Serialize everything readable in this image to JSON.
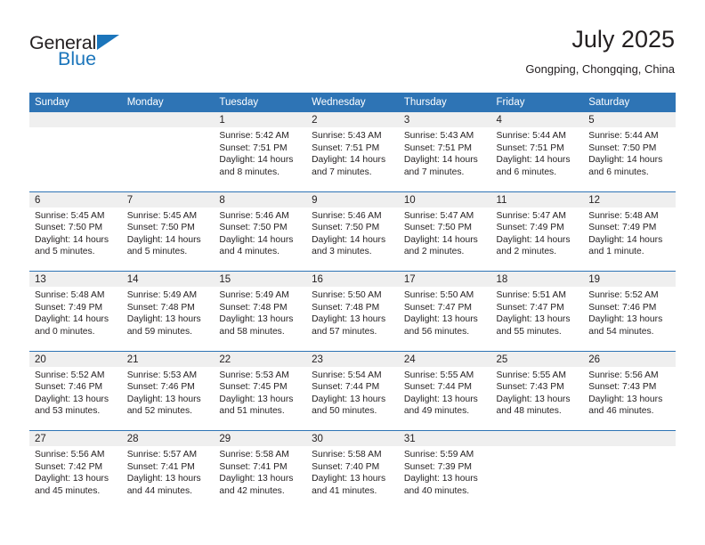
{
  "brand": {
    "name_top": "General",
    "name_bottom": "Blue",
    "accent_color": "#1b75bb"
  },
  "header": {
    "title": "July 2025",
    "subtitle": "Gongping, Chongqing, China"
  },
  "theme": {
    "header_bg": "#2e74b5",
    "header_text": "#ffffff",
    "daynum_bg": "#efefef",
    "separator": "#2e74b5",
    "body_text": "#231f20"
  },
  "weekdays": [
    "Sunday",
    "Monday",
    "Tuesday",
    "Wednesday",
    "Thursday",
    "Friday",
    "Saturday"
  ],
  "labels": {
    "sunrise": "Sunrise:",
    "sunset": "Sunset:",
    "daylight": "Daylight:"
  },
  "weeks": [
    {
      "days": [
        {
          "num": "",
          "sunrise": "",
          "sunset": "",
          "daylight_1": "",
          "daylight_2": ""
        },
        {
          "num": "",
          "sunrise": "",
          "sunset": "",
          "daylight_1": "",
          "daylight_2": ""
        },
        {
          "num": "1",
          "sunrise": "Sunrise: 5:42 AM",
          "sunset": "Sunset: 7:51 PM",
          "daylight_1": "Daylight: 14 hours",
          "daylight_2": "and 8 minutes."
        },
        {
          "num": "2",
          "sunrise": "Sunrise: 5:43 AM",
          "sunset": "Sunset: 7:51 PM",
          "daylight_1": "Daylight: 14 hours",
          "daylight_2": "and 7 minutes."
        },
        {
          "num": "3",
          "sunrise": "Sunrise: 5:43 AM",
          "sunset": "Sunset: 7:51 PM",
          "daylight_1": "Daylight: 14 hours",
          "daylight_2": "and 7 minutes."
        },
        {
          "num": "4",
          "sunrise": "Sunrise: 5:44 AM",
          "sunset": "Sunset: 7:51 PM",
          "daylight_1": "Daylight: 14 hours",
          "daylight_2": "and 6 minutes."
        },
        {
          "num": "5",
          "sunrise": "Sunrise: 5:44 AM",
          "sunset": "Sunset: 7:50 PM",
          "daylight_1": "Daylight: 14 hours",
          "daylight_2": "and 6 minutes."
        }
      ]
    },
    {
      "days": [
        {
          "num": "6",
          "sunrise": "Sunrise: 5:45 AM",
          "sunset": "Sunset: 7:50 PM",
          "daylight_1": "Daylight: 14 hours",
          "daylight_2": "and 5 minutes."
        },
        {
          "num": "7",
          "sunrise": "Sunrise: 5:45 AM",
          "sunset": "Sunset: 7:50 PM",
          "daylight_1": "Daylight: 14 hours",
          "daylight_2": "and 5 minutes."
        },
        {
          "num": "8",
          "sunrise": "Sunrise: 5:46 AM",
          "sunset": "Sunset: 7:50 PM",
          "daylight_1": "Daylight: 14 hours",
          "daylight_2": "and 4 minutes."
        },
        {
          "num": "9",
          "sunrise": "Sunrise: 5:46 AM",
          "sunset": "Sunset: 7:50 PM",
          "daylight_1": "Daylight: 14 hours",
          "daylight_2": "and 3 minutes."
        },
        {
          "num": "10",
          "sunrise": "Sunrise: 5:47 AM",
          "sunset": "Sunset: 7:50 PM",
          "daylight_1": "Daylight: 14 hours",
          "daylight_2": "and 2 minutes."
        },
        {
          "num": "11",
          "sunrise": "Sunrise: 5:47 AM",
          "sunset": "Sunset: 7:49 PM",
          "daylight_1": "Daylight: 14 hours",
          "daylight_2": "and 2 minutes."
        },
        {
          "num": "12",
          "sunrise": "Sunrise: 5:48 AM",
          "sunset": "Sunset: 7:49 PM",
          "daylight_1": "Daylight: 14 hours",
          "daylight_2": "and 1 minute."
        }
      ]
    },
    {
      "days": [
        {
          "num": "13",
          "sunrise": "Sunrise: 5:48 AM",
          "sunset": "Sunset: 7:49 PM",
          "daylight_1": "Daylight: 14 hours",
          "daylight_2": "and 0 minutes."
        },
        {
          "num": "14",
          "sunrise": "Sunrise: 5:49 AM",
          "sunset": "Sunset: 7:48 PM",
          "daylight_1": "Daylight: 13 hours",
          "daylight_2": "and 59 minutes."
        },
        {
          "num": "15",
          "sunrise": "Sunrise: 5:49 AM",
          "sunset": "Sunset: 7:48 PM",
          "daylight_1": "Daylight: 13 hours",
          "daylight_2": "and 58 minutes."
        },
        {
          "num": "16",
          "sunrise": "Sunrise: 5:50 AM",
          "sunset": "Sunset: 7:48 PM",
          "daylight_1": "Daylight: 13 hours",
          "daylight_2": "and 57 minutes."
        },
        {
          "num": "17",
          "sunrise": "Sunrise: 5:50 AM",
          "sunset": "Sunset: 7:47 PM",
          "daylight_1": "Daylight: 13 hours",
          "daylight_2": "and 56 minutes."
        },
        {
          "num": "18",
          "sunrise": "Sunrise: 5:51 AM",
          "sunset": "Sunset: 7:47 PM",
          "daylight_1": "Daylight: 13 hours",
          "daylight_2": "and 55 minutes."
        },
        {
          "num": "19",
          "sunrise": "Sunrise: 5:52 AM",
          "sunset": "Sunset: 7:46 PM",
          "daylight_1": "Daylight: 13 hours",
          "daylight_2": "and 54 minutes."
        }
      ]
    },
    {
      "days": [
        {
          "num": "20",
          "sunrise": "Sunrise: 5:52 AM",
          "sunset": "Sunset: 7:46 PM",
          "daylight_1": "Daylight: 13 hours",
          "daylight_2": "and 53 minutes."
        },
        {
          "num": "21",
          "sunrise": "Sunrise: 5:53 AM",
          "sunset": "Sunset: 7:46 PM",
          "daylight_1": "Daylight: 13 hours",
          "daylight_2": "and 52 minutes."
        },
        {
          "num": "22",
          "sunrise": "Sunrise: 5:53 AM",
          "sunset": "Sunset: 7:45 PM",
          "daylight_1": "Daylight: 13 hours",
          "daylight_2": "and 51 minutes."
        },
        {
          "num": "23",
          "sunrise": "Sunrise: 5:54 AM",
          "sunset": "Sunset: 7:44 PM",
          "daylight_1": "Daylight: 13 hours",
          "daylight_2": "and 50 minutes."
        },
        {
          "num": "24",
          "sunrise": "Sunrise: 5:55 AM",
          "sunset": "Sunset: 7:44 PM",
          "daylight_1": "Daylight: 13 hours",
          "daylight_2": "and 49 minutes."
        },
        {
          "num": "25",
          "sunrise": "Sunrise: 5:55 AM",
          "sunset": "Sunset: 7:43 PM",
          "daylight_1": "Daylight: 13 hours",
          "daylight_2": "and 48 minutes."
        },
        {
          "num": "26",
          "sunrise": "Sunrise: 5:56 AM",
          "sunset": "Sunset: 7:43 PM",
          "daylight_1": "Daylight: 13 hours",
          "daylight_2": "and 46 minutes."
        }
      ]
    },
    {
      "days": [
        {
          "num": "27",
          "sunrise": "Sunrise: 5:56 AM",
          "sunset": "Sunset: 7:42 PM",
          "daylight_1": "Daylight: 13 hours",
          "daylight_2": "and 45 minutes."
        },
        {
          "num": "28",
          "sunrise": "Sunrise: 5:57 AM",
          "sunset": "Sunset: 7:41 PM",
          "daylight_1": "Daylight: 13 hours",
          "daylight_2": "and 44 minutes."
        },
        {
          "num": "29",
          "sunrise": "Sunrise: 5:58 AM",
          "sunset": "Sunset: 7:41 PM",
          "daylight_1": "Daylight: 13 hours",
          "daylight_2": "and 42 minutes."
        },
        {
          "num": "30",
          "sunrise": "Sunrise: 5:58 AM",
          "sunset": "Sunset: 7:40 PM",
          "daylight_1": "Daylight: 13 hours",
          "daylight_2": "and 41 minutes."
        },
        {
          "num": "31",
          "sunrise": "Sunrise: 5:59 AM",
          "sunset": "Sunset: 7:39 PM",
          "daylight_1": "Daylight: 13 hours",
          "daylight_2": "and 40 minutes."
        },
        {
          "num": "",
          "sunrise": "",
          "sunset": "",
          "daylight_1": "",
          "daylight_2": ""
        },
        {
          "num": "",
          "sunrise": "",
          "sunset": "",
          "daylight_1": "",
          "daylight_2": ""
        }
      ]
    }
  ]
}
